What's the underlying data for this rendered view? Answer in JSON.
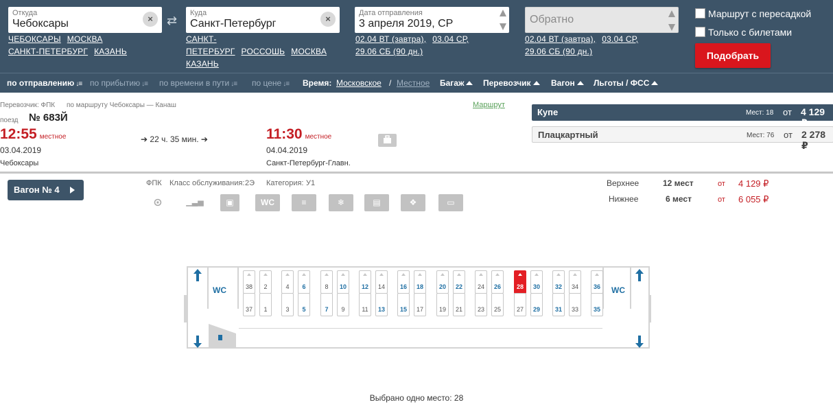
{
  "search": {
    "from": {
      "label": "Откуда",
      "value": "Чебоксары",
      "links": [
        "ЧЕБОКСАРЫ",
        "МОСКВА",
        "САНКТ-ПЕТЕРБУРГ",
        "КАЗАНЬ"
      ]
    },
    "to": {
      "label": "Куда",
      "value": "Санкт-Петербург",
      "links": [
        "САНКТ-ПЕТЕРБУРГ",
        "РОССОШЬ",
        "МОСКВА",
        "КАЗАНЬ"
      ]
    },
    "date": {
      "label": "Дата отправления",
      "value": "3 апреля 2019, СР",
      "links": [
        "02.04 ВТ (завтра),",
        "03.04 СР,",
        "29.06 СБ (90 дн.)"
      ]
    },
    "back": {
      "placeholder": "Обратно",
      "links": [
        "02.04 ВТ (завтра),",
        "03.04 СР,",
        "29.06 СБ (90 дн.)"
      ]
    },
    "clear_glyph": "×",
    "swap_glyph": "⇄",
    "transfer_label": "Маршрут с пересадкой",
    "tickets_only_label": "Только с билетами",
    "submit_label": "Подобрать",
    "submit_color": "#d9161d"
  },
  "sortbar": {
    "by_departure": "по отправлению",
    "by_arrival": "по прибытию",
    "by_duration": "по времени в пути",
    "by_price": "по цене",
    "time_label": "Время:",
    "time_moscow": "Московское",
    "time_sep": "/",
    "time_local": "Местное",
    "baggage": "Багаж",
    "carrier": "Перевозчик",
    "car": "Вагон",
    "benefits": "Льготы / ФСС"
  },
  "train": {
    "carrier_line": "Перевозчик: ФПК",
    "route_line": "по маршруту Чебоксары — Канаш",
    "route_link": "Маршрут",
    "number_prefix": "поезд",
    "number": "№ 683Й",
    "departure": {
      "time": "12:55",
      "tz": "местное",
      "date": "03.04.2019",
      "station": "Чебоксары"
    },
    "duration": "22 ч. 35 мин.",
    "arrival": {
      "time": "11:30",
      "tz": "местное",
      "date": "04.04.2019",
      "station": "Санкт-Петербург-Главн."
    }
  },
  "tariffs": [
    {
      "name": "Купе",
      "seats": "Мест: 18",
      "from": "от",
      "price": "4 129 ₽"
    },
    {
      "name": "Плацкартный",
      "seats": "Мест: 76",
      "from": "от",
      "price": "2 278 ₽"
    }
  ],
  "car": {
    "button_label": "Вагон",
    "number": "№ 4",
    "carrier": "ФПК",
    "class_label": "Класс обслуживания:",
    "class_value": "2Э",
    "category_label": "Категория:",
    "category_value": "У1",
    "services": [
      "restaurant-icon",
      "climate-chart-icon",
      "bag-icon",
      "wc-icon",
      "towel-icon",
      "snowflake-icon",
      "newspaper-icon",
      "pet-paw-icon",
      "linen-icon"
    ],
    "service_wc_text": "WC",
    "berths": [
      {
        "name": "Верхнее",
        "count": "12 мест",
        "from": "от",
        "price": "4 129 ₽"
      },
      {
        "name": "Нижнее",
        "count": "6 мест",
        "from": "от",
        "price": "6 055 ₽"
      }
    ],
    "wc_label": "WC",
    "seats_upper": [
      "38",
      "2",
      "4",
      "6",
      "8",
      "10",
      "12",
      "14",
      "16",
      "18",
      "20",
      "22",
      "24",
      "26",
      "28",
      "30",
      "32",
      "34",
      "36"
    ],
    "seats_lower": [
      "37",
      "1",
      "3",
      "5",
      "7",
      "9",
      "11",
      "13",
      "15",
      "17",
      "19",
      "21",
      "23",
      "25",
      "27",
      "29",
      "31",
      "33",
      "35"
    ],
    "free_seats": [
      "6",
      "10",
      "12",
      "16",
      "18",
      "20",
      "22",
      "26",
      "30",
      "32",
      "36",
      "5",
      "7",
      "13",
      "15",
      "29",
      "31",
      "35"
    ],
    "selected_seat": "28",
    "selected_text": "Выбрано одно место: 28"
  },
  "colors": {
    "panel": "#3d5468",
    "accent_red": "#c41e24",
    "seat_free": "#1f6fa3",
    "link_green": "#5aa15a"
  }
}
